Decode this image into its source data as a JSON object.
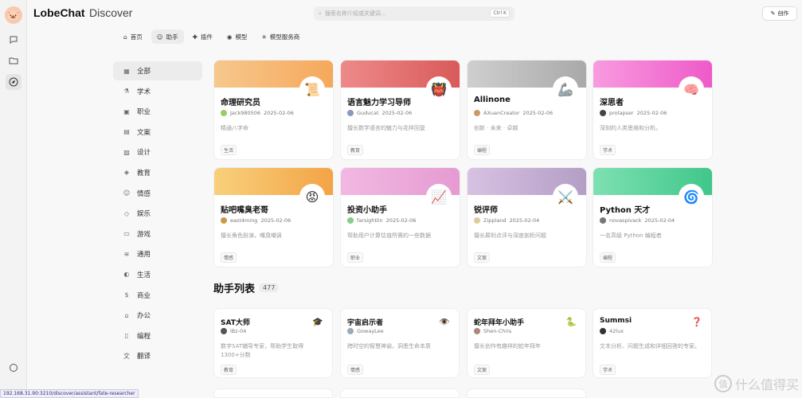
{
  "app": {
    "brand": "LobeChat",
    "section": "Discover"
  },
  "search": {
    "placeholder": "搜索名称介绍或关键词...",
    "shortcut": "Ctrl K"
  },
  "create_label": "创作",
  "nav_tabs": [
    {
      "label": "首页",
      "icon": "home-icon"
    },
    {
      "label": "助手",
      "icon": "bot-icon"
    },
    {
      "label": "插件",
      "icon": "puzzle-icon"
    },
    {
      "label": "模型",
      "icon": "model-icon"
    },
    {
      "label": "模型服务商",
      "icon": "provider-icon"
    }
  ],
  "categories": [
    {
      "label": "全部",
      "icon": "grid-icon"
    },
    {
      "label": "学术",
      "icon": "academic-icon"
    },
    {
      "label": "职业",
      "icon": "briefcase-icon"
    },
    {
      "label": "文案",
      "icon": "doc-icon"
    },
    {
      "label": "设计",
      "icon": "image-icon"
    },
    {
      "label": "教育",
      "icon": "graduation-icon"
    },
    {
      "label": "情感",
      "icon": "smile-icon"
    },
    {
      "label": "娱乐",
      "icon": "ticket-icon"
    },
    {
      "label": "游戏",
      "icon": "gamepad-icon"
    },
    {
      "label": "通用",
      "icon": "layers-icon"
    },
    {
      "label": "生活",
      "icon": "cup-icon"
    },
    {
      "label": "商业",
      "icon": "dollar-icon"
    },
    {
      "label": "办公",
      "icon": "office-icon"
    },
    {
      "label": "编程",
      "icon": "code-icon"
    },
    {
      "label": "翻译",
      "icon": "translate-icon"
    }
  ],
  "featured": [
    {
      "title": "命理研究员",
      "author": "Jack980506",
      "date": "2025-02-06",
      "desc": "精通八字命",
      "tag": "生活",
      "avatar": "📜",
      "color": "#f6b06d"
    },
    {
      "title": "语言魅力学习导师",
      "author": "Guducat",
      "date": "2025-02-06",
      "desc": "擅长数学语言的魅力与花样回复",
      "tag": "教育",
      "avatar": "👹",
      "color": "#e26a6a"
    },
    {
      "title": "Allinone",
      "author": "AXuanCreator",
      "date": "2025-02-06",
      "desc": "创新 · 未来 · 卓越",
      "tag": "编程",
      "avatar": "🦾",
      "color": "#b3b3b3"
    },
    {
      "title": "深思者",
      "author": "prolapser",
      "date": "2025-02-06",
      "desc": "深刻的人类思维和分析。",
      "tag": "学术",
      "avatar": "🧠",
      "color": "#f27ad6"
    },
    {
      "title": "贴吧嘴臭老哥",
      "author": "east4ming",
      "date": "2025-02-06",
      "desc": "擅长角色扮演，嘴臭嘲讽",
      "tag": "情感",
      "avatar": "😡",
      "color": "#f5b553"
    },
    {
      "title": "投资小助手",
      "author": "farsightlin",
      "date": "2025-02-06",
      "desc": "帮助用户计算估值所需的一些数据",
      "tag": "职业",
      "avatar": "📈",
      "color": "#e7a6d6"
    },
    {
      "title": "锐评师",
      "author": "Zippland",
      "date": "2025-02-04",
      "desc": "擅长犀利点评与深度剖析问题",
      "tag": "文案",
      "avatar": "⚔️",
      "color": "#c2a9cf"
    },
    {
      "title": "Python 天才",
      "author": "novaspivack",
      "date": "2025-02-04",
      "desc": "一名高级 Python 编程者",
      "tag": "编程",
      "avatar": "🌀",
      "color": "#5fd39e"
    }
  ],
  "list_section": {
    "title": "助手列表",
    "count": "477"
  },
  "assistants": [
    {
      "title": "SAT大师",
      "author": "iBz-04",
      "desc": "数字SAT辅导专家，帮助学生取得1300+分数",
      "tag": "教育",
      "avatar": "🎓"
    },
    {
      "title": "宇宙启示者",
      "author": "GowayLee",
      "desc": "跨时空的智慧神谕，洞悉生命本质",
      "tag": "情感",
      "avatar": "👁️"
    },
    {
      "title": "蛇年拜年小助手",
      "author": "Shen-Chris",
      "desc": "擅长创作有趣祥的蛇年拜年",
      "tag": "文案",
      "avatar": "🐍"
    },
    {
      "title": "Summsi",
      "author": "42lux",
      "desc": "文本分析、问题生成和详细回答的专家。",
      "tag": "学术",
      "avatar": "❓"
    }
  ],
  "status_url": "192.168.31.90:3210/discover/assistant/fate-researcher",
  "watermark": "什么值得买",
  "watermark_badge": "值"
}
